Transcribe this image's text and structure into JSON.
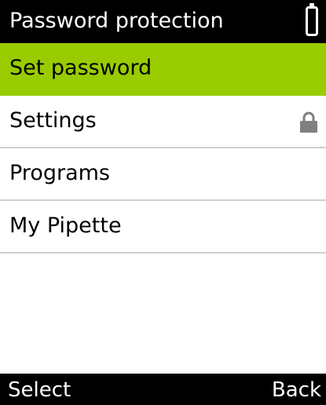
{
  "header": {
    "title": "Password protection",
    "battery_icon": "battery-icon"
  },
  "menu": {
    "items": [
      {
        "label": "Set password",
        "selected": true
      },
      {
        "label": "Settings",
        "icon": "lock-icon"
      },
      {
        "label": "Programs"
      },
      {
        "label": "My Pipette"
      }
    ]
  },
  "softkeys": {
    "left": "Select",
    "right": "Back"
  },
  "colors": {
    "highlight": "#99cc00",
    "bar": "#000000",
    "divider": "#cfcfcf",
    "lock": "#808080"
  }
}
